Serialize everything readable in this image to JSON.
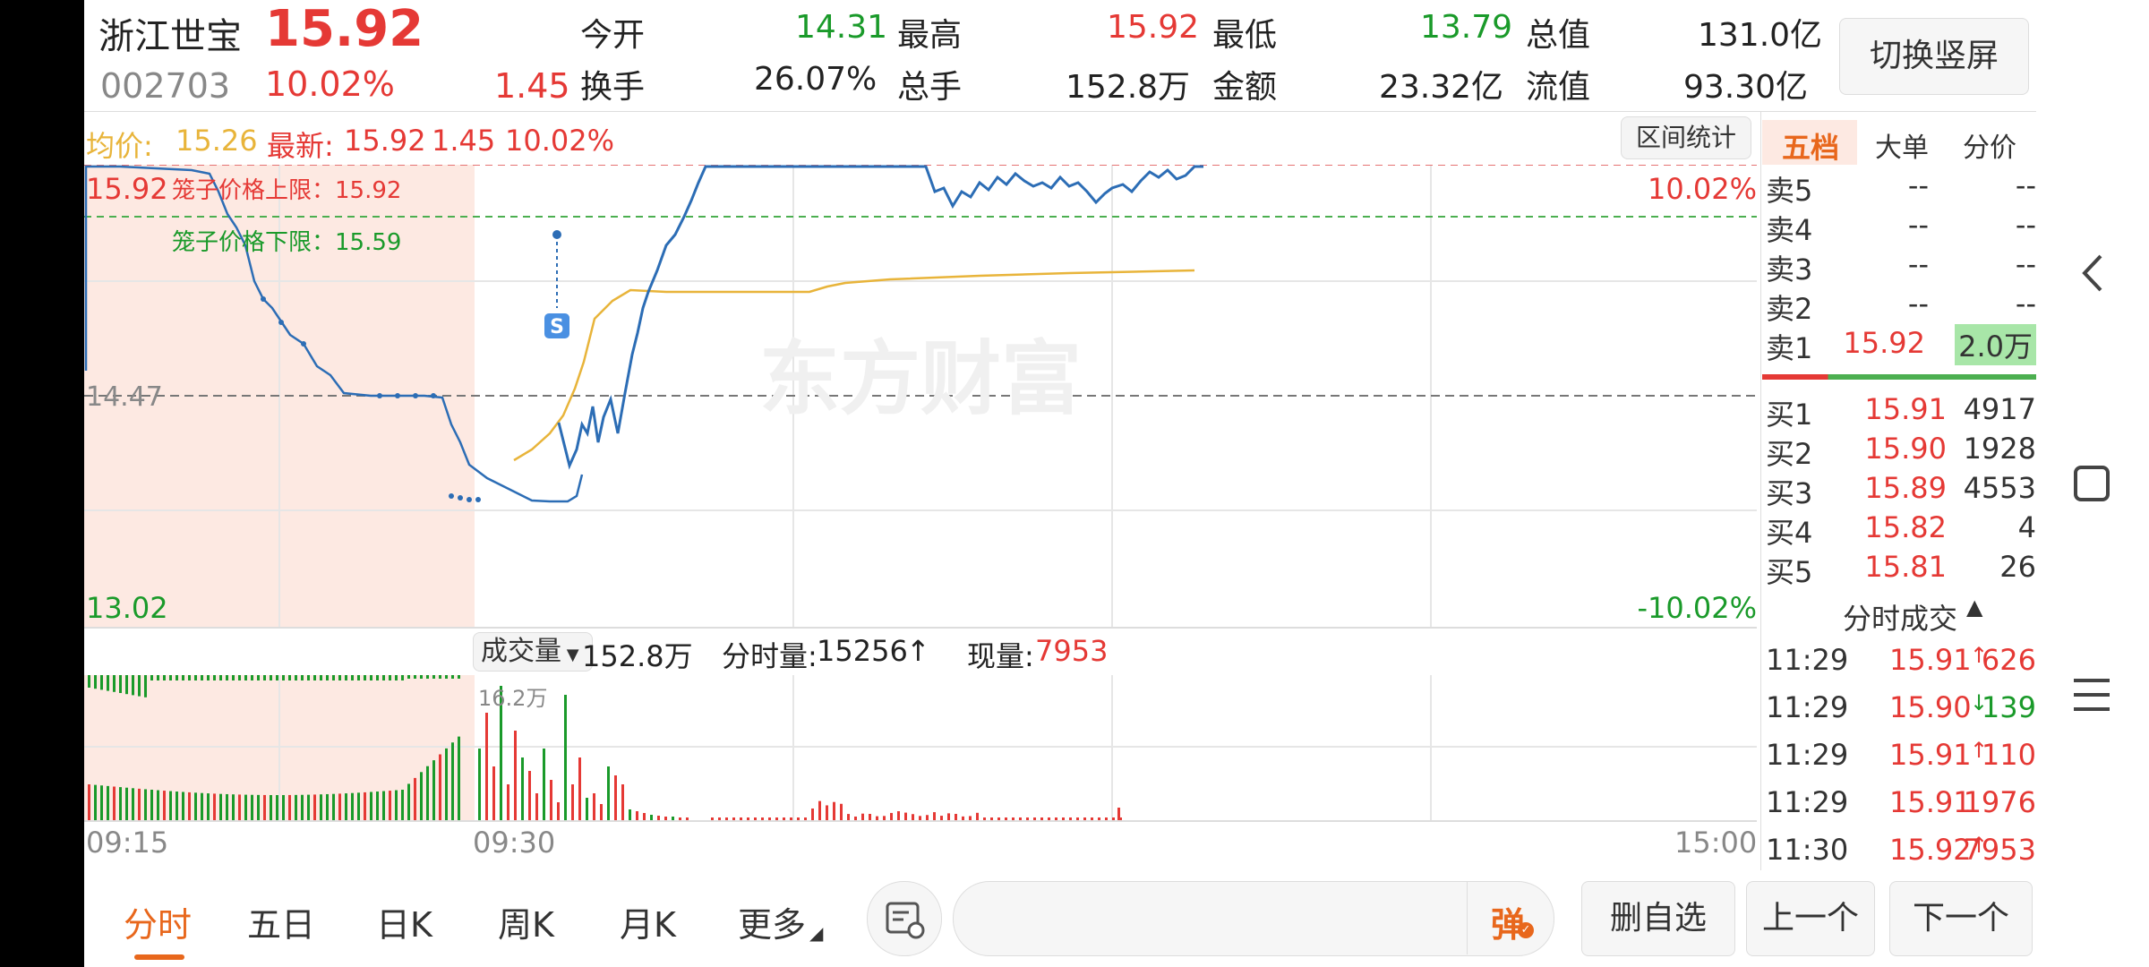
{
  "header": {
    "name": "浙江世宝",
    "code": "002703",
    "price": "15.92",
    "pct": "10.02%",
    "change": "1.45",
    "open_label": "今开",
    "open_value": "14.31",
    "high_label": "最高",
    "high_value": "15.92",
    "low_label": "最低",
    "low_value": "13.79",
    "total_mv_label": "总值",
    "total_mv_value": "131.0亿",
    "turnover_label": "换手",
    "turnover_value": "26.07%",
    "volume_label": "总手",
    "volume_value": "152.8万",
    "amount_label": "金额",
    "amount_value": "23.32亿",
    "float_mv_label": "流值",
    "float_mv_value": "93.30亿",
    "orientation_button": "切换竖屏"
  },
  "chart_info": {
    "avg_label": "均价:",
    "avg_value": "15.26",
    "latest_label": "最新:",
    "latest_value": "15.92",
    "latest_change": "1.45",
    "latest_pct": "10.02%",
    "range_stats_button": "区间统计",
    "price_high_label": "15.92",
    "price_mid_label": "14.47",
    "price_low_label": "13.02",
    "pct_high_label": "10.02%",
    "pct_low_label": "-10.02%",
    "cage_upper": "笼子价格上限：15.92",
    "cage_lower": "笼子价格下限：15.59",
    "watermark": "东方财富",
    "marker": "S"
  },
  "volume_info": {
    "selector": "成交量",
    "total": "152.8万",
    "minute_label": "分时量:",
    "minute_value": "15256",
    "minute_arrow": "↑",
    "now_label": "现量:",
    "now_value": "7953",
    "max_label": "16.2万"
  },
  "time_axis": {
    "start": "09:15",
    "mid": "09:30",
    "end": "15:00"
  },
  "order_book": {
    "tabs": [
      "五档",
      "大单",
      "分价"
    ],
    "sells": [
      {
        "label": "卖5",
        "price": "--",
        "vol": "--"
      },
      {
        "label": "卖4",
        "price": "--",
        "vol": "--"
      },
      {
        "label": "卖3",
        "price": "--",
        "vol": "--"
      },
      {
        "label": "卖2",
        "price": "--",
        "vol": "--"
      },
      {
        "label": "卖1",
        "price": "15.92",
        "vol": "2.0万"
      }
    ],
    "buys": [
      {
        "label": "买1",
        "price": "15.91",
        "vol": "4917"
      },
      {
        "label": "买2",
        "price": "15.90",
        "vol": "1928"
      },
      {
        "label": "买3",
        "price": "15.89",
        "vol": "4553"
      },
      {
        "label": "买4",
        "price": "15.82",
        "vol": "4"
      },
      {
        "label": "买5",
        "price": "15.81",
        "vol": "26"
      }
    ],
    "tape_title": "分时成交",
    "tape": [
      {
        "time": "11:29",
        "price": "15.91",
        "dir": "↑",
        "vol": "626"
      },
      {
        "time": "11:29",
        "price": "15.90",
        "dir": "↓",
        "vol": "139"
      },
      {
        "time": "11:29",
        "price": "15.91",
        "dir": "↑",
        "vol": "110"
      },
      {
        "time": "11:29",
        "price": "15.91",
        "dir": "",
        "vol": "1976"
      },
      {
        "time": "11:30",
        "price": "15.92",
        "dir": "↑",
        "vol": "7953"
      }
    ]
  },
  "bottom_bar": {
    "tabs": [
      "分时",
      "五日",
      "日K",
      "周K",
      "月K",
      "更多"
    ],
    "danmu_button": "弹",
    "remove_button": "删自选",
    "prev_button": "上一个",
    "next_button": "下一个"
  },
  "colors": {
    "up": "#e53935",
    "down": "#1a9a2a",
    "price_line": "#2c6db5",
    "avg_line": "#e8b43a",
    "accent": "#e8671c"
  }
}
